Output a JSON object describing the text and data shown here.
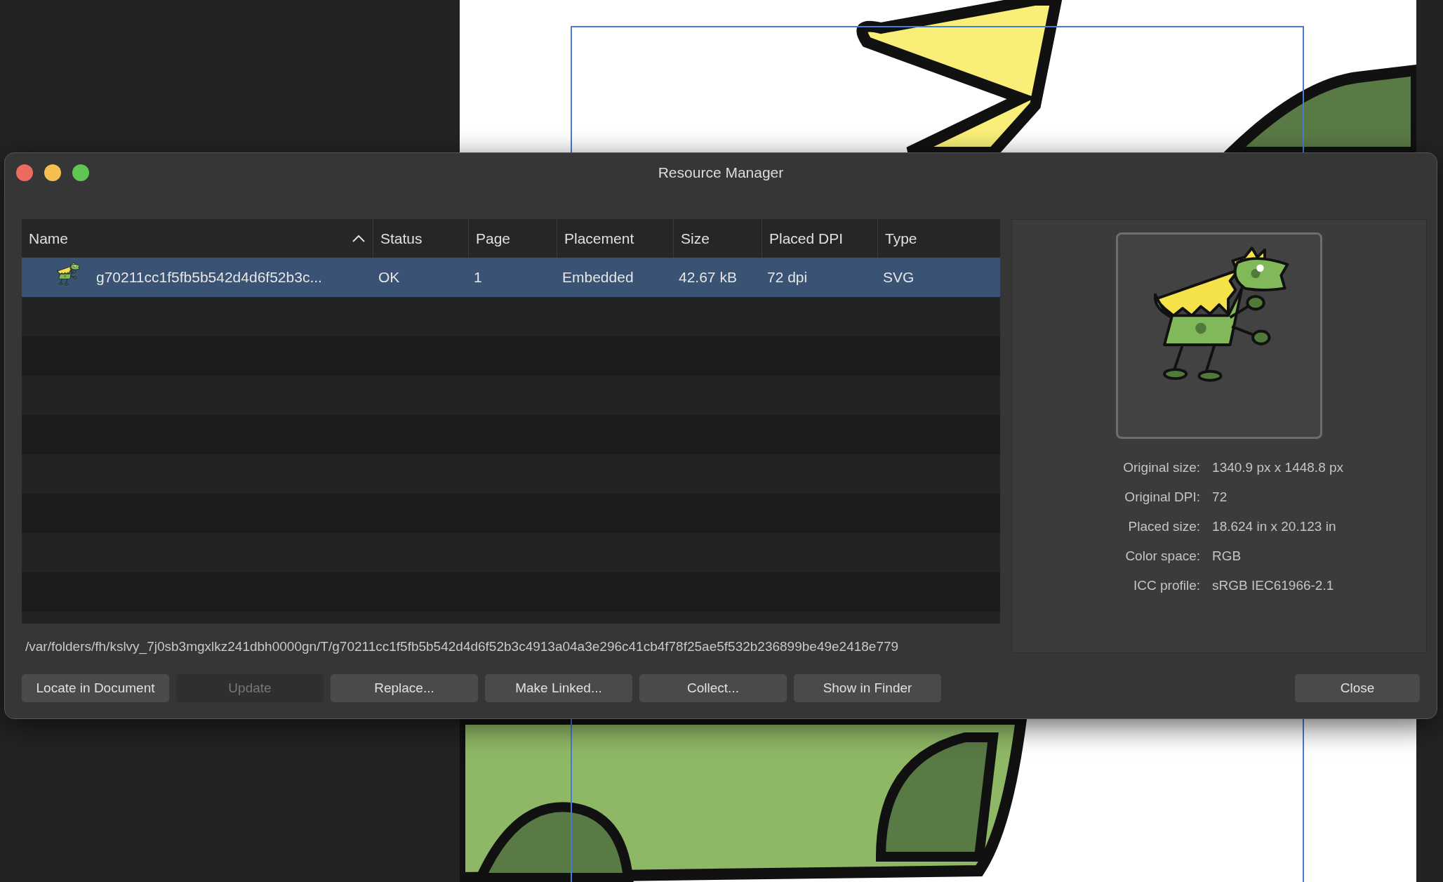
{
  "window": {
    "title": "Resource Manager"
  },
  "table": {
    "columns": [
      {
        "label": "Name",
        "sorted": true
      },
      {
        "label": "Status",
        "sorted": false
      },
      {
        "label": "Page",
        "sorted": false
      },
      {
        "label": "Placement",
        "sorted": false
      },
      {
        "label": "Size",
        "sorted": false
      },
      {
        "label": "Placed DPI",
        "sorted": false
      },
      {
        "label": "Type",
        "sorted": false
      }
    ],
    "rows": [
      {
        "selected": true,
        "cells": [
          "g70211cc1f5fb5b542d4d6f52b3c...",
          "OK",
          "1",
          "Embedded",
          "42.67 kB",
          "72 dpi",
          "SVG"
        ]
      }
    ]
  },
  "details": [
    {
      "label": "Original size:",
      "value": "1340.9 px x 1448.8 px"
    },
    {
      "label": "Original DPI:",
      "value": "72"
    },
    {
      "label": "Placed size:",
      "value": "18.624 in x 20.123 in"
    },
    {
      "label": "Color space:",
      "value": "RGB"
    },
    {
      "label": "ICC profile:",
      "value": "sRGB IEC61966-2.1"
    }
  ],
  "path": "/var/folders/fh/kslvy_7j0sb3mgxlkz241dbh0000gn/T/g70211cc1f5fb5b542d4d6f52b3c4913a04a3e296c41cb4f78f25ae5f532b236899be49e2418e779",
  "buttons": [
    {
      "label": "Locate in Document",
      "disabled": false
    },
    {
      "label": "Update",
      "disabled": true
    },
    {
      "label": "Replace...",
      "disabled": false
    },
    {
      "label": "Make Linked...",
      "disabled": false
    },
    {
      "label": "Collect...",
      "disabled": false
    },
    {
      "label": "Show in Finder",
      "disabled": false
    }
  ],
  "close_button": {
    "label": "Close"
  }
}
